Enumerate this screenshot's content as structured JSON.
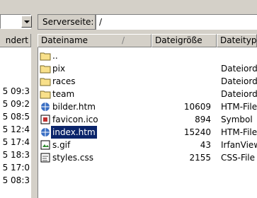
{
  "left_pane": {
    "header_label": "ndert",
    "times": [
      "5 09:3",
      "5 09:2",
      "5 08:5",
      "5 12:4",
      "5 17:4",
      "5 18:3",
      "5 17:0",
      "5 08:3"
    ]
  },
  "server": {
    "label": "Serverseite:",
    "path": "/"
  },
  "columns": {
    "name": "Dateiname",
    "sort_indicator": "/",
    "size": "Dateigröße",
    "type": "Dateityp"
  },
  "files": [
    {
      "name": "..",
      "size": "",
      "type": "",
      "icon": "folder-up-icon"
    },
    {
      "name": "pix",
      "size": "",
      "type": "Dateiord",
      "icon": "folder-icon"
    },
    {
      "name": "races",
      "size": "",
      "type": "Dateiord",
      "icon": "folder-icon"
    },
    {
      "name": "team",
      "size": "",
      "type": "Dateiord",
      "icon": "folder-icon"
    },
    {
      "name": "bilder.htm",
      "size": "10609",
      "type": "HTM-File",
      "icon": "html-file-icon"
    },
    {
      "name": "favicon.ico",
      "size": "894",
      "type": "Symbol",
      "icon": "ico-file-icon"
    },
    {
      "name": "index.htm",
      "size": "15240",
      "type": "HTM-File",
      "icon": "html-file-icon"
    },
    {
      "name": "s.gif",
      "size": "43",
      "type": "IrfanView",
      "icon": "gif-file-icon"
    },
    {
      "name": "styles.css",
      "size": "2155",
      "type": "CSS-File",
      "icon": "css-file-icon"
    }
  ],
  "selected_index": 6,
  "colors": {
    "selection": "#0a246a",
    "window_bg": "#d4d0c8",
    "folder_yellow": "#f8e08a"
  }
}
